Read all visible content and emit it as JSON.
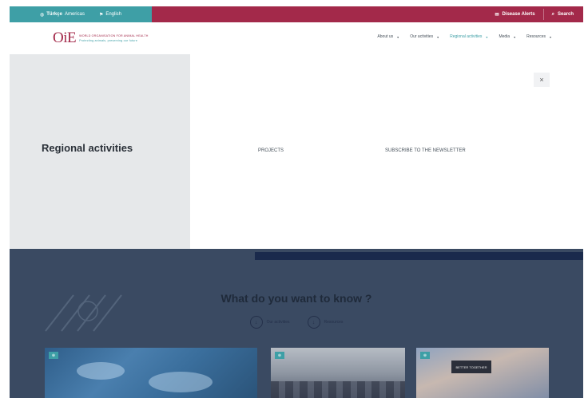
{
  "topbar": {
    "lang_primary": "Türkçe",
    "lang_region": "Americas",
    "lang_secondary": "English",
    "alerts_label": "Disease Alerts",
    "search_label": "Search",
    "left_color": "#3e9fa6",
    "right_color": "#a3294a"
  },
  "header": {
    "logo_mark": "OiE",
    "logo_line1": "WORLD ORGANISATION FOR ANIMAL HEALTH",
    "logo_line2": "Protecting animals, preserving our future",
    "nav": [
      {
        "label": "About us"
      },
      {
        "label": "Our activities"
      },
      {
        "label": "Regional activities",
        "active": true
      },
      {
        "label": "Media"
      },
      {
        "label": "Resources"
      }
    ]
  },
  "hero": {
    "title": "Regional activities",
    "close_icon": "×",
    "link_projects": "PROJECTS",
    "link_subscribe": "SUBSCRIBE TO THE NEWSLETTER"
  },
  "bottom": {
    "heading": "What do you want to know ?",
    "choice_1": "Our activities",
    "choice_2": "Resources",
    "card_1_tag": "⊕",
    "card_2_tag": "⊕",
    "card_3_tag": "⊕",
    "card_3_sign": "BETTER TOGETHER"
  }
}
